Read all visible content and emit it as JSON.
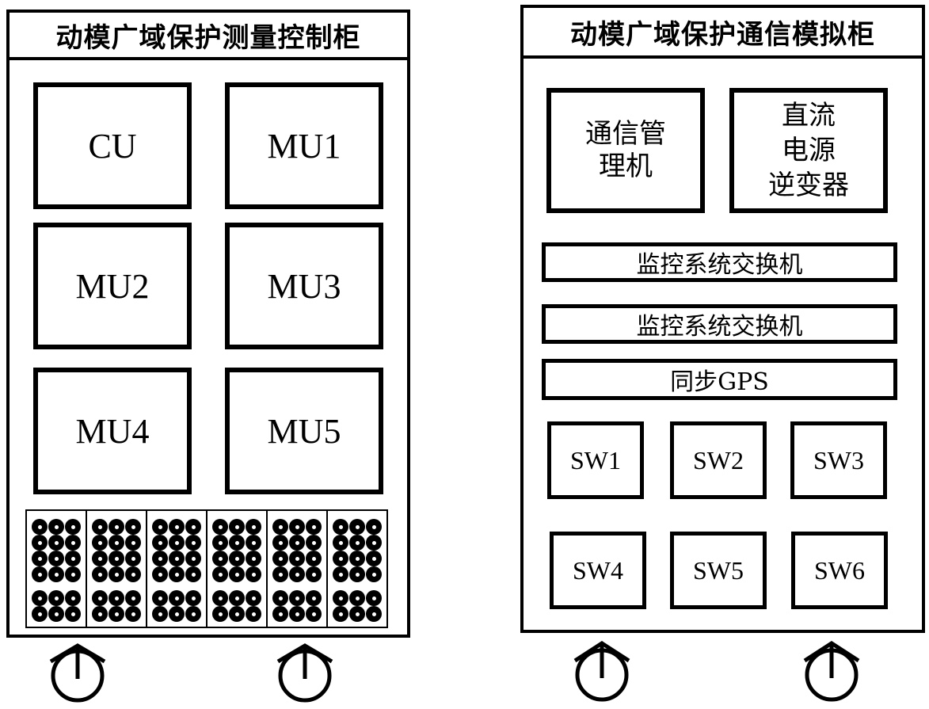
{
  "left_cabinet": {
    "title": "动模广域保护测量控制柜",
    "units": [
      "CU",
      "MU1",
      "MU2",
      "MU3",
      "MU4",
      "MU5"
    ],
    "terminal_panel": {
      "columns": 6,
      "rows_per_column": 6,
      "terminals_per_row": 3
    },
    "wheels": 2
  },
  "right_cabinet": {
    "title": "动模广域保护通信模拟柜",
    "comm_manager": "通信管\n理机",
    "comm_manager_lines": [
      "通信管",
      "理机"
    ],
    "dc_inverter_lines": [
      "直流",
      "电源",
      "逆变器"
    ],
    "bars": [
      "监控系统交换机",
      "监控系统交换机",
      "同步GPS"
    ],
    "switches": [
      "SW1",
      "SW2",
      "SW3",
      "SW4",
      "SW5",
      "SW6"
    ],
    "wheels": 2
  }
}
